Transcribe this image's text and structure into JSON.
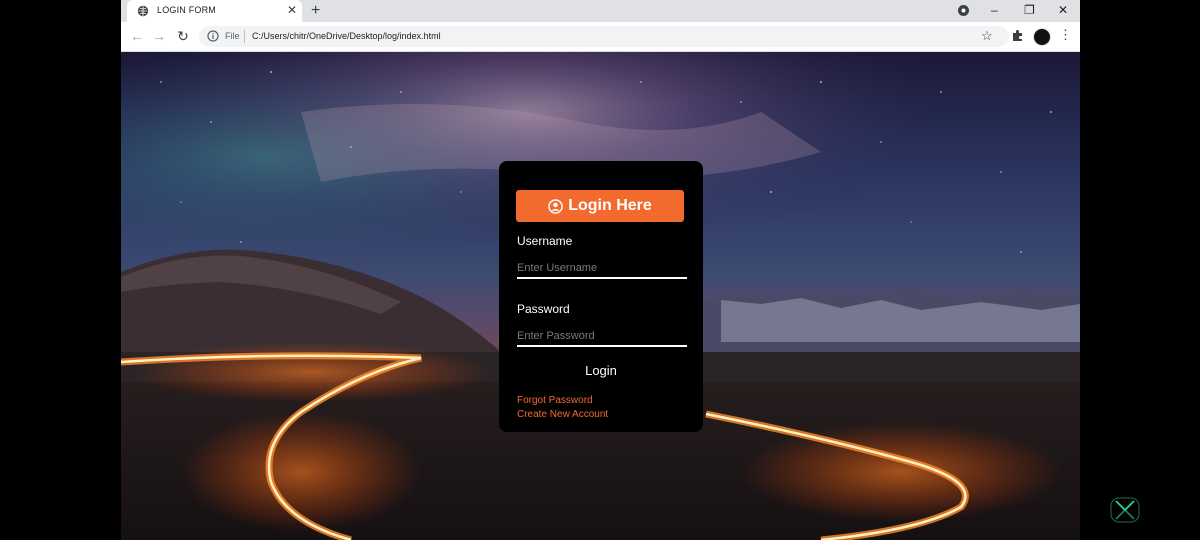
{
  "browser": {
    "tab_title": "LOGIN FORM",
    "new_tab_symbol": "+",
    "close_tab_symbol": "✕",
    "file_label": "File",
    "url": "C:/Users/chitr/OneDrive/Desktop/log/index.html",
    "window_controls": {
      "minimize": "–",
      "restore": "❐",
      "close": "✕"
    }
  },
  "login": {
    "header": "Login Here",
    "username_label": "Username",
    "username_placeholder": "Enter Username",
    "password_label": "Password",
    "password_placeholder": "Enter Password",
    "submit_label": "Login",
    "forgot_link": "Forgot Password",
    "create_link": "Create New Account"
  },
  "icons": {
    "tab_favicon": "globe-icon",
    "info": "info-icon",
    "bookmark": "star-icon",
    "extensions": "puzzle-icon",
    "menu": "kebab-menu-icon",
    "header": "user-circle-icon"
  },
  "colors": {
    "accent": "#f26a2e",
    "panel": "#000000"
  }
}
